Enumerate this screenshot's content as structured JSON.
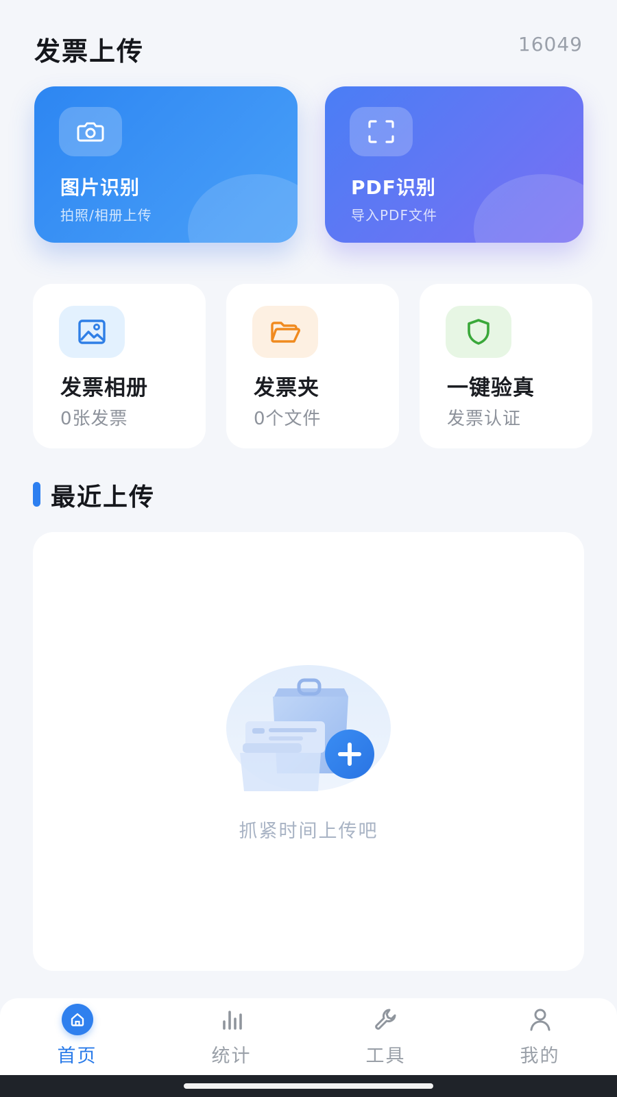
{
  "header": {
    "title": "发票上传",
    "count": "16049"
  },
  "big_cards": [
    {
      "title": "图片识别",
      "subtitle": "拍照/相册上传",
      "icon": "camera-icon"
    },
    {
      "title": "PDF识别",
      "subtitle": "导入PDF文件",
      "icon": "scan-frame-icon"
    }
  ],
  "small_cards": [
    {
      "title": "发票相册",
      "subtitle": "0张发票",
      "icon": "image-icon",
      "icon_color": "#2f7fe6",
      "icon_bg": "#e3f1fe"
    },
    {
      "title": "发票夹",
      "subtitle": "0个文件",
      "icon": "folder-icon",
      "icon_color": "#f08a1f",
      "icon_bg": "#fdf0e2"
    },
    {
      "title": "一键验真",
      "subtitle": "发票认证",
      "icon": "shield-icon",
      "icon_color": "#3aa83a",
      "icon_bg": "#e7f6e4"
    }
  ],
  "recent": {
    "title": "最近上传",
    "empty_text": "抓紧时间上传吧"
  },
  "nav": [
    {
      "label": "首页",
      "icon": "home-icon",
      "active": true
    },
    {
      "label": "统计",
      "icon": "bar-chart-icon",
      "active": false
    },
    {
      "label": "工具",
      "icon": "wrench-icon",
      "active": false
    },
    {
      "label": "我的",
      "icon": "user-icon",
      "active": false
    }
  ],
  "colors": {
    "primary": "#2f80ee",
    "background": "#f4f6fa",
    "pdf_gradient_end": "#7a6ff3"
  }
}
